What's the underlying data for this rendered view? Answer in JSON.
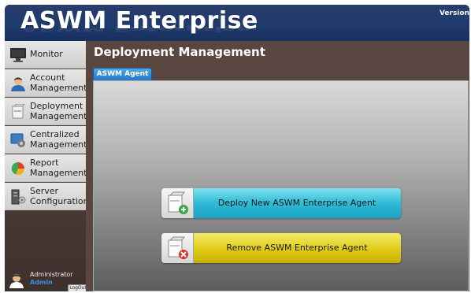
{
  "app": {
    "title": "ASWM Enterprise",
    "version": "Version"
  },
  "sidebar": {
    "items": [
      {
        "label": "Monitor",
        "icon": "monitor-icon"
      },
      {
        "label": "Account\nManagement",
        "icon": "account-icon"
      },
      {
        "label": "Deployment\nManagement",
        "icon": "deployment-icon"
      },
      {
        "label": "Centralized\nManagement",
        "icon": "centralized-icon"
      },
      {
        "label": "Report\nManagement",
        "icon": "report-icon"
      },
      {
        "label": "Server\nConfiguration",
        "icon": "server-icon"
      }
    ],
    "user": {
      "name": "Administrator",
      "role": "Admin",
      "logout_label": "LogOut"
    }
  },
  "main": {
    "title": "Deployment Management",
    "tab": "ASWM Agent",
    "actions": {
      "deploy_label": "Deploy New ASWM Enterprise Agent",
      "remove_label": "Remove ASWM Enterprise Agent"
    }
  },
  "colors": {
    "header": "#1f3a6d",
    "deploy": "#2fbad6",
    "remove": "#e0cb17",
    "tab": "#2f86d1"
  }
}
